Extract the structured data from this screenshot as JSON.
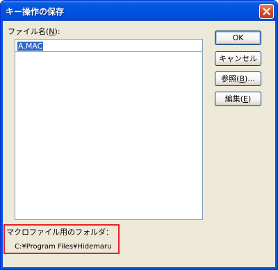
{
  "window": {
    "title": "キー操作の保存"
  },
  "filename": {
    "label": "ファイル名",
    "accel": "N",
    "label_suffix": ":",
    "value": "A.MAC"
  },
  "buttons": {
    "ok": "OK",
    "cancel": "キャンセル",
    "browse": {
      "text": "参照",
      "accel": "B",
      "suffix": "..."
    },
    "edit": {
      "text": "編集",
      "accel": "E"
    }
  },
  "macro_folder": {
    "label": "マクロファイル用のフォルダ：",
    "path": "C:¥Program Files¥Hidemaru"
  },
  "icons": {
    "close": "close-icon"
  },
  "colors": {
    "title_bar": "#0054e3",
    "dialog_bg": "#ece9d8",
    "selection": "#316ac5",
    "highlight_frame": "#ee1c25"
  }
}
